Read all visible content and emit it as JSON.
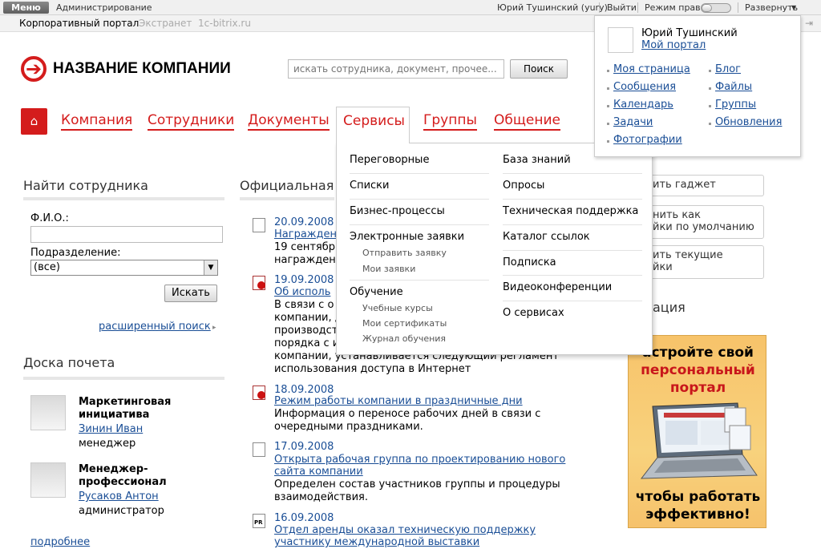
{
  "topbar": {
    "menu_label": "Меню",
    "admin_label": "Администрирование",
    "user_label": "Юрий Тушинский (yury)",
    "logout_label": "Выйти",
    "edit_mode_label": "Режим правки",
    "expand_label": "Развернуть"
  },
  "tabs": {
    "corp": "Корпоративный портал",
    "extranet": "Экстранет",
    "b24": "1c-bitrix.ru"
  },
  "header": {
    "company_name": "НАЗВАНИЕ КОМПАНИИ",
    "search_placeholder": "искать сотрудника, документ, прочее...",
    "search_button": "Поиск"
  },
  "nav": {
    "company": "Компания",
    "employees": "Сотрудники",
    "documents": "Документы",
    "services": "Сервисы",
    "groups": "Группы",
    "communication": "Общение"
  },
  "services_menu": {
    "col1": {
      "meeting_rooms": "Переговорные",
      "lists": "Списки",
      "bp": "Бизнес-процессы",
      "requests": "Электронные заявки",
      "send_request": "Отправить заявку",
      "my_requests": "Мои заявки",
      "learning": "Обучение",
      "courses": "Учебные курсы",
      "certificates": "Мои сертификаты",
      "journal": "Журнал обучения"
    },
    "col2": {
      "kb": "База знаний",
      "polls": "Опросы",
      "support": "Техническая поддержка",
      "links": "Каталог ссылок",
      "subscription": "Подписка",
      "video": "Видеоконференции",
      "about": "О сервисах"
    }
  },
  "user_popup": {
    "name": "Юрий Тушинский",
    "my_portal": "Мой портал",
    "links_left": [
      "Моя страница",
      "Сообщения",
      "Календарь",
      "Задачи",
      "Фотографии"
    ],
    "links_right": [
      "Блог",
      "Файлы",
      "Группы",
      "Обновления"
    ]
  },
  "find_employee": {
    "title": "Найти сотрудника",
    "fio_label": "Ф.И.О.:",
    "dept_label": "Подразделение:",
    "dept_value": "(все)",
    "find_button": "Искать",
    "advanced": "расширенный поиск"
  },
  "honor_board": {
    "title": "Доска почета",
    "people": [
      {
        "title1": "Маркетинговая",
        "title2": "инициатива",
        "name": "Зинин Иван",
        "role": "менеджер"
      },
      {
        "title1": "Менеджер-",
        "title2": "профессионал",
        "name": "Русаков Антон",
        "role": "администратор"
      }
    ],
    "more": "подробнее"
  },
  "news": {
    "title": "Официальная",
    "items": [
      {
        "date": "20.09.2008",
        "link1": "Награжден",
        "link2": "",
        "text": [
          "19 сентябр",
          "награжден"
        ]
      },
      {
        "date": "19.09.2008",
        "link1": "Об исполь",
        "link2": "",
        "text": [
          "В связи с о",
          "компании, д",
          "производст",
          "порядка с и",
          "компании, устанавливается следующий регламент",
          "использования доступа в Интернет"
        ]
      },
      {
        "date": "18.09.2008",
        "link1": "Режим работы компании в праздничные дни",
        "link2": "",
        "text": [
          "Информация о переносе рабочих дней в связи с",
          "очередными праздниками."
        ]
      },
      {
        "date": "17.09.2008",
        "link1": "Открыта рабочая группа по проектированию нового",
        "link2": "сайта компании",
        "text": [
          "Определен состав участников группы и процедуры",
          "взаимодействия."
        ]
      },
      {
        "date": "16.09.2008",
        "link1": "Отдел аренды оказал техническую поддержку",
        "link2": "участнику международной выставки",
        "text": []
      }
    ]
  },
  "right_panel": {
    "btn_gadget": "ить гаджет",
    "btn_default1": "нить как",
    "btn_default2": "йки по умолчанию",
    "btn_current1": "ить текущие",
    "btn_current2": "йки",
    "section": "ация",
    "banner_top": [
      "астройте свой",
      "персональный",
      "портал"
    ],
    "banner_bottom": [
      "чтобы работать",
      "эффективно!"
    ]
  },
  "colors": {
    "accent": "#d41c1c",
    "link": "#1a4e96"
  }
}
